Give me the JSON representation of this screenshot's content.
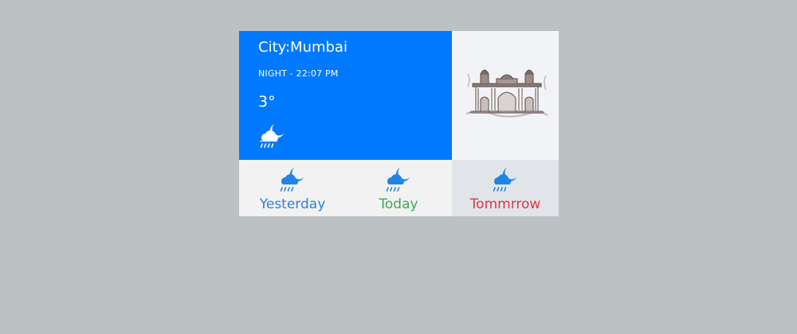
{
  "weather": {
    "city": "City:Mumbai",
    "time": "NIGHT - 22:07 PM",
    "temperature": "3°",
    "condition_icon": "rain-night-icon"
  },
  "landmark": {
    "icon": "gateway-of-india-image"
  },
  "forecast": [
    {
      "label": "Yesterday",
      "icon": "rain-night-icon",
      "color": "#2b7fd9"
    },
    {
      "label": "Today",
      "icon": "rain-night-icon",
      "color": "#3ea854"
    },
    {
      "label": "Tommrrow",
      "icon": "rain-night-icon",
      "color": "#dc3545"
    }
  ],
  "colors": {
    "accent": "#0079fe",
    "page_background": "#bcc1c4",
    "forecast_icon": "#1f84e6"
  }
}
